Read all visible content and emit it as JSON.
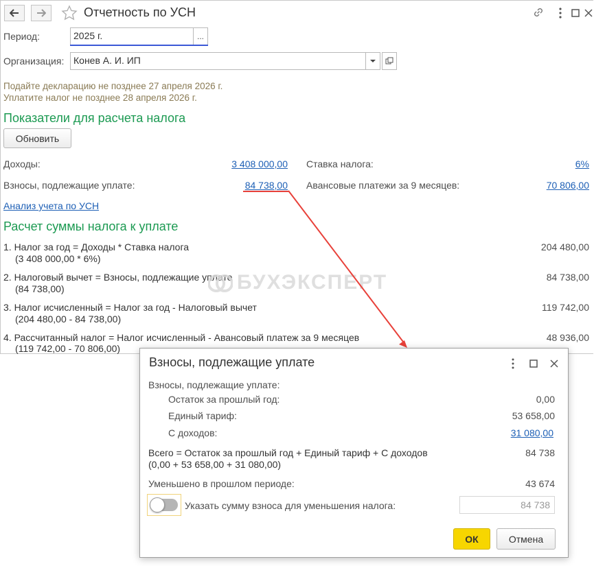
{
  "window": {
    "title": "Отчетность по УСН",
    "back_icon": "arrow-left-icon",
    "forward_icon": "arrow-right-icon",
    "star_icon": "star-outline-icon",
    "link_icon": "link-icon",
    "more_icon": "more-vertical-icon",
    "maximize_icon": "maximize-icon",
    "close_icon": "close-icon"
  },
  "period": {
    "label": "Период:",
    "value": "2025 г.",
    "select_label": "..."
  },
  "organization": {
    "label": "Организация:",
    "value": "Конев А. И. ИП"
  },
  "notices": {
    "declaration": "Подайте декларацию не позднее 27 апреля 2026 г.",
    "payment": "Уплатите налог не позднее 28 апреля 2026 г."
  },
  "indicators": {
    "title": "Показатели для расчета налога",
    "refresh_label": "Обновить",
    "income_label": "Доходы:",
    "income_value": "3 408 000,00",
    "rate_label": "Ставка налога:",
    "rate_value": "6%",
    "contributions_label": "Взносы, подлежащие уплате:",
    "contributions_value": "84 738,00",
    "advance_label": "Авансовые платежи за 9 месяцев:",
    "advance_value": "70 806,00",
    "analysis_link": "Анализ учета по УСН"
  },
  "calc": {
    "title": "Расчет суммы налога к уплате",
    "rows": [
      {
        "formula": "1. Налог за год = Доходы * Ставка налога",
        "detail": "(3 408 000,00 * 6%)",
        "value": "204 480,00"
      },
      {
        "formula": "2. Налоговый вычет = Взносы, подлежащие уплате",
        "detail": "(84 738,00)",
        "value": "84 738,00"
      },
      {
        "formula": "3. Налог исчисленный = Налог за год - Налоговый вычет",
        "detail": "(204 480,00 - 84 738,00)",
        "value": "119 742,00"
      },
      {
        "formula": "4. Рассчитанный налог = Налог исчисленный - Авансовый платеж за 9 месяцев",
        "detail": "(119 742,00 - 70 806,00)",
        "value": "48 936,00"
      }
    ]
  },
  "watermark": "БУХЭКСПЕРТ",
  "dialog": {
    "title": "Взносы, подлежащие уплате",
    "header": "Взносы, подлежащие уплате:",
    "items": [
      {
        "label": "Остаток за прошлый год:",
        "value": "0,00"
      },
      {
        "label": "Единый тариф:",
        "value": "53 658,00"
      },
      {
        "label": "С доходов:",
        "value": "31 080,00"
      }
    ],
    "total_formula": "Всего = Остаток за прошлый год + Единый тариф + С доходов",
    "total_detail": "(0,00 + 53 658,00 + 31 080,00)",
    "total_value": "84 738",
    "reduced_label": "Уменьшено в прошлом периоде:",
    "reduced_value": "43 674",
    "toggle_label": "Указать сумму взноса для уменьшения налога:",
    "amount_input": "84 738",
    "toggle_on": false,
    "ok_label": "ОК",
    "cancel_label": "Отмена"
  },
  "colors": {
    "accent_green": "#1c9a52",
    "link_blue": "#1d5fb5",
    "notice": "#8a7b55",
    "annotation_red": "#e8413a",
    "ok_yellow": "#f7d600"
  }
}
